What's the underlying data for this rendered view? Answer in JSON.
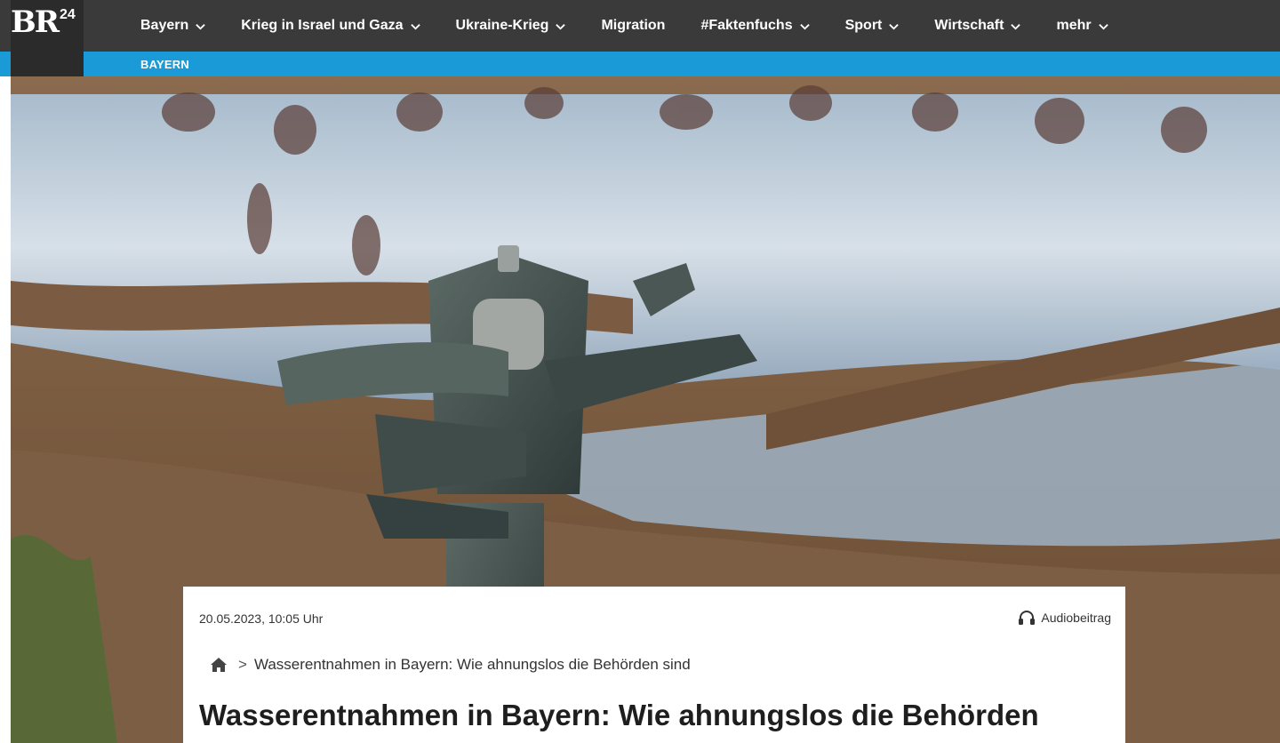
{
  "header": {
    "logo": {
      "text": "BR",
      "superscript": "24"
    },
    "nav": [
      {
        "label": "Bayern",
        "has_dropdown": true
      },
      {
        "label": "Krieg in Israel und Gaza",
        "has_dropdown": true
      },
      {
        "label": "Ukraine-Krieg",
        "has_dropdown": true
      },
      {
        "label": "Migration",
        "has_dropdown": false
      },
      {
        "label": "#Faktenfuchs",
        "has_dropdown": true
      },
      {
        "label": "Sport",
        "has_dropdown": true
      },
      {
        "label": "Wirtschaft",
        "has_dropdown": true
      },
      {
        "label": "mehr",
        "has_dropdown": true
      }
    ],
    "section_label": "BAYERN"
  },
  "hero": {
    "image_subject": "sprinkler"
  },
  "article": {
    "date": "20.05.2023, 10:05 Uhr",
    "audio_label": "Audiobeitrag",
    "breadcrumb_separator": ">",
    "breadcrumb_current": "Wasserentnahmen in Bayern: Wie ahnungslos die Behörden sind",
    "headline": "Wasserentnahmen in Bayern: Wie ahnungslos die Behörden"
  },
  "colors": {
    "topbar": "#3a3a3a",
    "subbar": "#1a9ad6",
    "logo_bg": "#2b2b2b"
  }
}
